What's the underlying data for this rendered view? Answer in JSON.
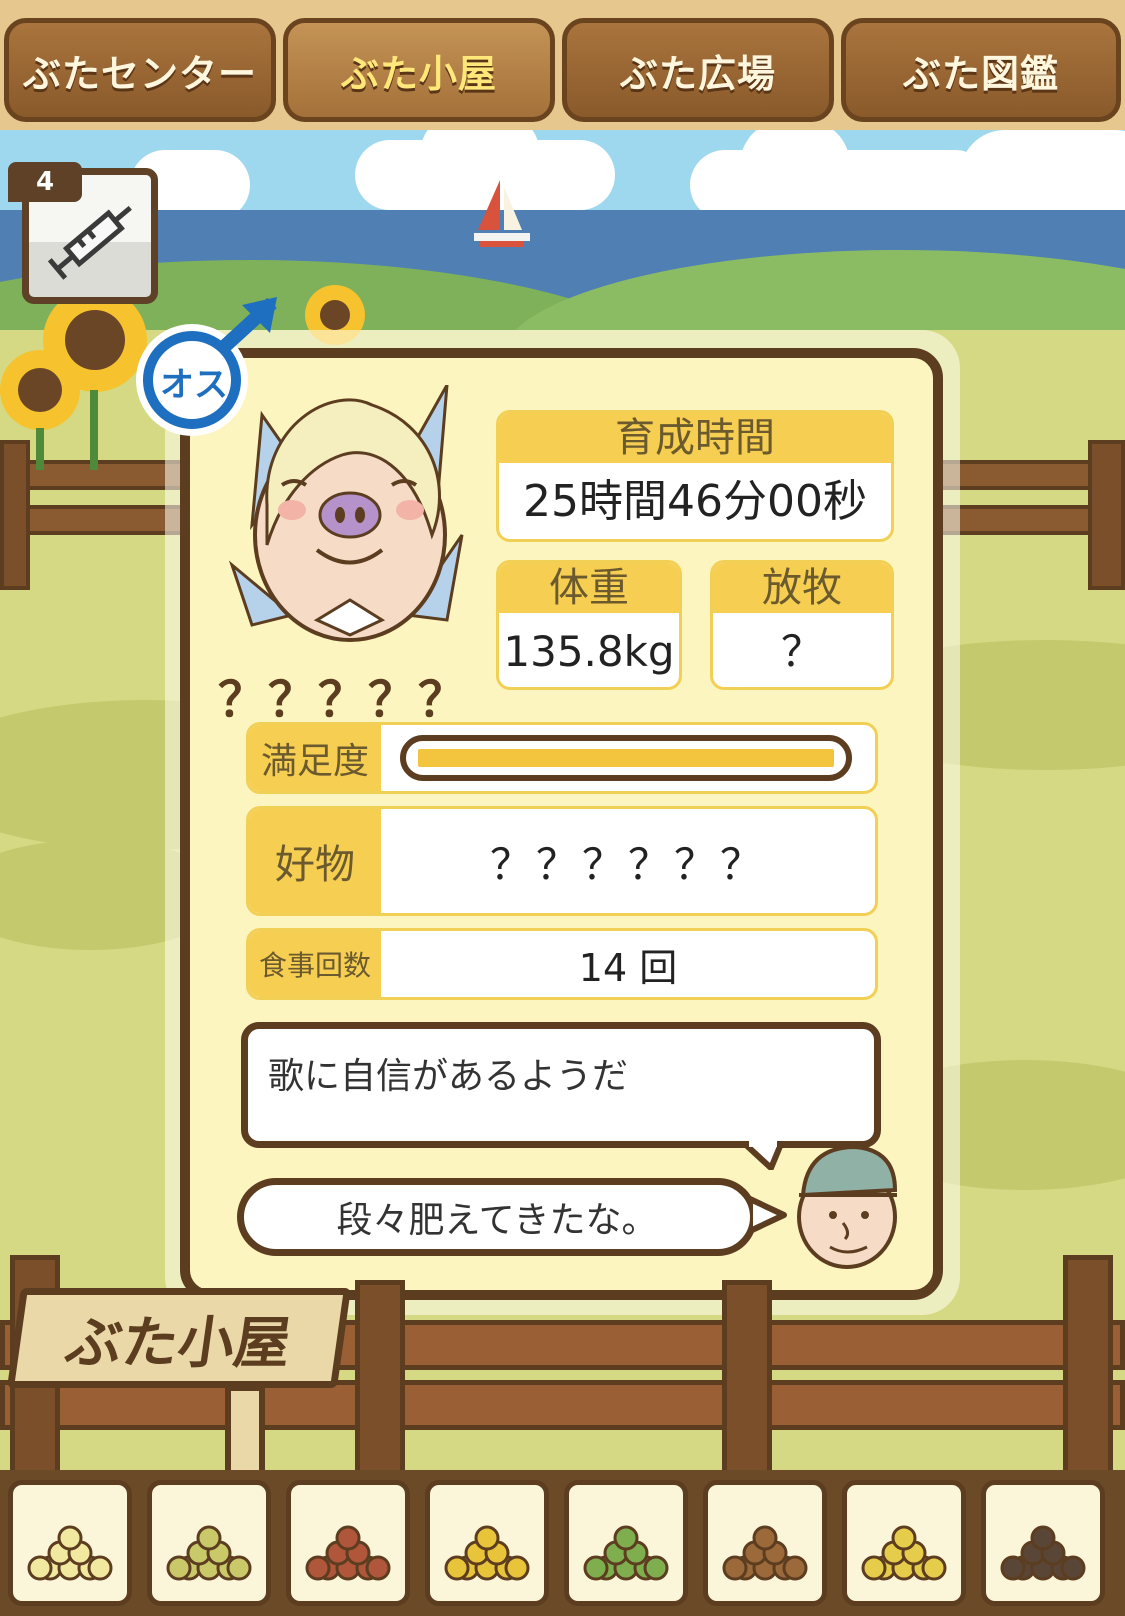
{
  "tabs": [
    {
      "label": "ぶたセンター",
      "active": false
    },
    {
      "label": "ぶた小屋",
      "active": true
    },
    {
      "label": "ぶた広場",
      "active": false
    },
    {
      "label": "ぶた図鑑",
      "active": false
    }
  ],
  "item_slot": {
    "count": "4",
    "icon": "syringe-icon"
  },
  "pig": {
    "gender_label": "オス",
    "gender_icon": "male-symbol-icon",
    "name": "？？？？？"
  },
  "stats": {
    "growth_time_label": "育成時間",
    "growth_time_value": "25時間46分00秒",
    "weight_label": "体重",
    "weight_value": "135.8kg",
    "graze_label": "放牧",
    "graze_value": "？",
    "satisfaction_label": "満足度",
    "satisfaction_level": 1.0,
    "favorite_label": "好物",
    "favorite_value": "？？？？？？",
    "meals_label": "食事回数",
    "meals_value": "14 回"
  },
  "comment": "歌に自信があるようだ",
  "farmer_speech": "段々肥えてきたな。",
  "sign_label": "ぶた小屋",
  "foods": [
    {
      "name": "soybeans-icon",
      "color": "#f2e9a0"
    },
    {
      "name": "mixed-beans-icon",
      "color": "#c9c96a"
    },
    {
      "name": "sweet-potato-icon",
      "color": "#b0563b"
    },
    {
      "name": "corn-icon",
      "color": "#e8c43a"
    },
    {
      "name": "vegetables-icon",
      "color": "#7fae4f"
    },
    {
      "name": "acorns-icon",
      "color": "#9c6a3a"
    },
    {
      "name": "grain-plate-icon",
      "color": "#e5cc4a"
    },
    {
      "name": "truffles-icon",
      "color": "#5a4636"
    }
  ]
}
